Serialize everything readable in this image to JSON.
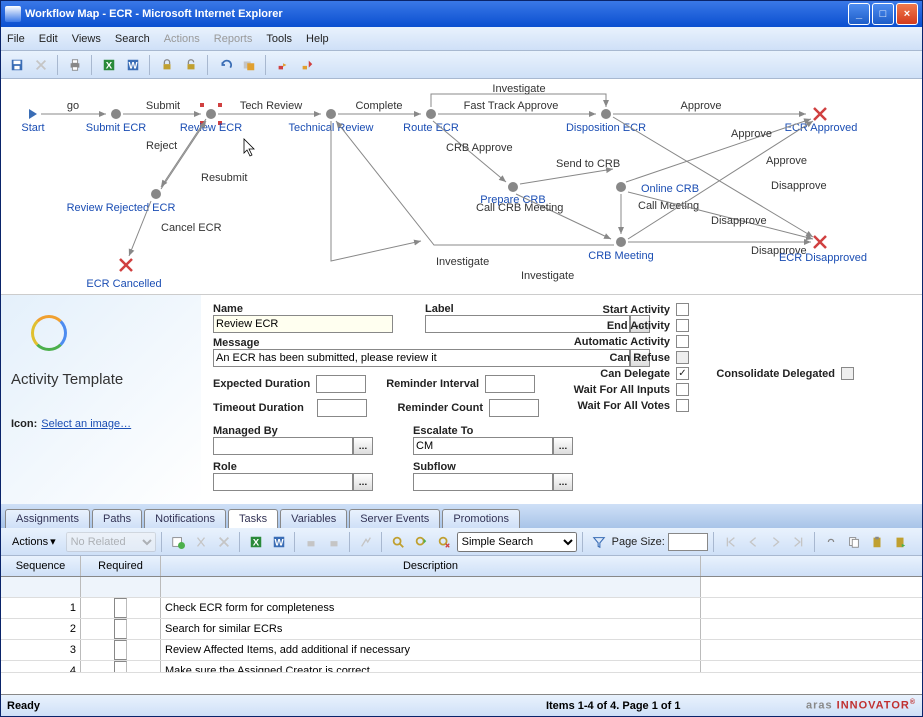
{
  "window": {
    "title": "Workflow Map - ECR - Microsoft Internet Explorer"
  },
  "menus": {
    "file": "File",
    "edit": "Edit",
    "views": "Views",
    "search": "Search",
    "actions": "Actions",
    "reports": "Reports",
    "tools": "Tools",
    "help": "Help"
  },
  "diagram": {
    "nodes": {
      "start": "Start",
      "submit_ecr": "Submit ECR",
      "review_ecr": "Review ECR",
      "technical_review": "Technical Review",
      "route_ecr": "Route ECR",
      "disposition_ecr": "Disposition ECR",
      "ecr_approved": "ECR Approved",
      "review_rejected_ecr": "Review Rejected ECR",
      "ecr_cancelled": "ECR Cancelled",
      "prepare_crb": "Prepare CRB",
      "online_crb": "Online CRB",
      "crb_meeting": "CRB Meeting",
      "ecr_disapproved": "ECR Disapproved"
    },
    "edges": {
      "go": "go",
      "submit": "Submit",
      "tech_review": "Tech Review",
      "complete": "Complete",
      "fast_track_approve": "Fast Track Approve",
      "approve": "Approve",
      "reject": "Reject",
      "resubmit": "Resubmit",
      "cancel_ecr": "Cancel ECR",
      "investigate": "Investigate",
      "crb_approve": "CRB Approve",
      "send_to_crb": "Send to CRB",
      "call_crb_meeting": "Call CRB Meeting",
      "call_meeting": "Call Meeting",
      "disapprove": "Disapprove"
    }
  },
  "form": {
    "section_title": "Activity Template",
    "select_image": "Select an image…",
    "icon_label": "Icon:",
    "labels": {
      "name": "Name",
      "label": "Label",
      "message": "Message",
      "expected_duration": "Expected Duration",
      "reminder_interval": "Reminder Interval",
      "timeout_duration": "Timeout Duration",
      "reminder_count": "Reminder Count",
      "managed_by": "Managed By",
      "escalate_to": "Escalate To",
      "role": "Role",
      "subflow": "Subflow",
      "start_activity": "Start Activity",
      "end_activity": "End Activity",
      "automatic_activity": "Automatic Activity",
      "can_refuse": "Can Refuse",
      "can_delegate": "Can Delegate",
      "consolidate_delegated": "Consolidate Delegated",
      "wait_for_all_inputs": "Wait For All Inputs",
      "wait_for_all_votes": "Wait For All Votes"
    },
    "values": {
      "name": "Review ECR",
      "label": "",
      "message": "An ECR has been submitted, please review it",
      "expected_duration": "",
      "timeout_duration": "",
      "reminder_interval": "",
      "reminder_count": "",
      "managed_by": "",
      "escalate_to": "CM",
      "role": "",
      "subflow": "",
      "can_delegate_checked": "✓"
    }
  },
  "tabs": {
    "assignments": "Assignments",
    "paths": "Paths",
    "notifications": "Notifications",
    "tasks": "Tasks",
    "variables": "Variables",
    "server_events": "Server Events",
    "promotions": "Promotions"
  },
  "grid_toolbar": {
    "actions": "Actions",
    "no_related": "No Related",
    "simple_search": "Simple Search",
    "page_size": "Page Size:"
  },
  "grid": {
    "headers": {
      "sequence": "Sequence",
      "required": "Required",
      "description": "Description"
    },
    "rows": [
      {
        "seq": "1",
        "req": false,
        "desc": "Check ECR form for completeness"
      },
      {
        "seq": "2",
        "req": false,
        "desc": "Search for similar ECRs"
      },
      {
        "seq": "3",
        "req": false,
        "desc": "Review Affected Items, add additional if necessary"
      },
      {
        "seq": "4",
        "req": false,
        "desc": "Make sure the Assigned Creator is correct"
      }
    ]
  },
  "status": {
    "ready": "Ready",
    "pager": "Items 1-4 of 4. Page 1 of 1",
    "brand_a": "aras",
    "brand_b": "INNOVATOR"
  }
}
